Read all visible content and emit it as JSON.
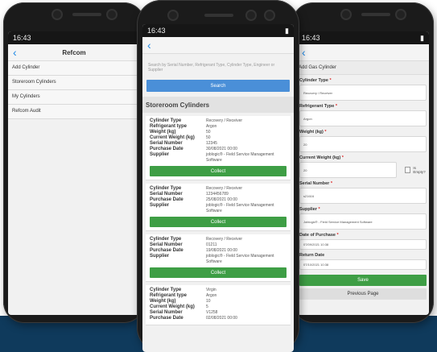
{
  "status": {
    "time": "16:43"
  },
  "left_screen": {
    "title": "Refcom",
    "menu": [
      "Add Cylinder",
      "Storeroom Cylinders",
      "My Cylinders",
      "Refcom Audit"
    ]
  },
  "middle_screen": {
    "search_placeholder": "Search by Serial Number, Refrigerant Type, Cylinder Type, Engineer or Supplier",
    "search_label": "Search",
    "section_title": "Storeroom Cylinders",
    "collect_label": "Collect",
    "cards": [
      {
        "rows": [
          {
            "k": "Cylinder Type",
            "v": "Recovery / Receiver"
          },
          {
            "k": "Refrigerant type",
            "v": "Argon"
          },
          {
            "k": "Weight (kg)",
            "v": "50"
          },
          {
            "k": "Current Weight (kg)",
            "v": "50"
          },
          {
            "k": "Serial Number",
            "v": "12345"
          },
          {
            "k": "Purchase Date",
            "v": "30/08/2021 00:00"
          },
          {
            "k": "Supplier",
            "v": "joblogic® - Field Service Management Software"
          }
        ]
      },
      {
        "rows": [
          {
            "k": "Cylinder Type",
            "v": "Recovery / Receiver"
          },
          {
            "k": "Serial Number",
            "v": "1234456789"
          },
          {
            "k": "Purchase Date",
            "v": "25/08/2021 00:00"
          },
          {
            "k": "Supplier",
            "v": "joblogic® - Field Service Management Software"
          }
        ]
      },
      {
        "rows": [
          {
            "k": "Cylinder Type",
            "v": "Recovery / Receiver"
          },
          {
            "k": "Serial Number",
            "v": "01211"
          },
          {
            "k": "Purchase Date",
            "v": "19/08/2021 00:00"
          },
          {
            "k": "Supplier",
            "v": "joblogic® - Field Service Management Software"
          }
        ]
      },
      {
        "rows": [
          {
            "k": "Cylinder Type",
            "v": "Virgin"
          },
          {
            "k": "Refrigerant type",
            "v": "Argon"
          },
          {
            "k": "Weight (kg)",
            "v": "10"
          },
          {
            "k": "Current Weight (kg)",
            "v": "5"
          },
          {
            "k": "Serial Number",
            "v": "V1258"
          },
          {
            "k": "Purchase Date",
            "v": "02/08/2021 00:00"
          }
        ]
      }
    ]
  },
  "right_screen": {
    "form_title": "Add Gas Cylinder",
    "cylinder_type_label": "Cylinder Type",
    "cylinder_type_value": "Recovery / Receiver",
    "refrigerant_label": "Refrigerant Type",
    "refrigerant_value": "Argon",
    "weight_label": "Weight (kg)",
    "weight_value": "20",
    "current_weight_label": "Current Weight (kg)",
    "current_weight_value": "20",
    "is_empty_label": "Is Empty?",
    "serial_label": "Serial Number",
    "serial_value": "s21616",
    "supplier_label": "Supplier",
    "supplier_value": "Joblogic® - Field Service Management Software",
    "purchase_label": "Date of Purchase",
    "purchase_value": "07/09/2021 10:38",
    "return_label": "Return Date",
    "return_value": "07/10/2021 10:38",
    "required_mark": "*",
    "save_label": "Save",
    "previous_label": "Previous Page"
  }
}
